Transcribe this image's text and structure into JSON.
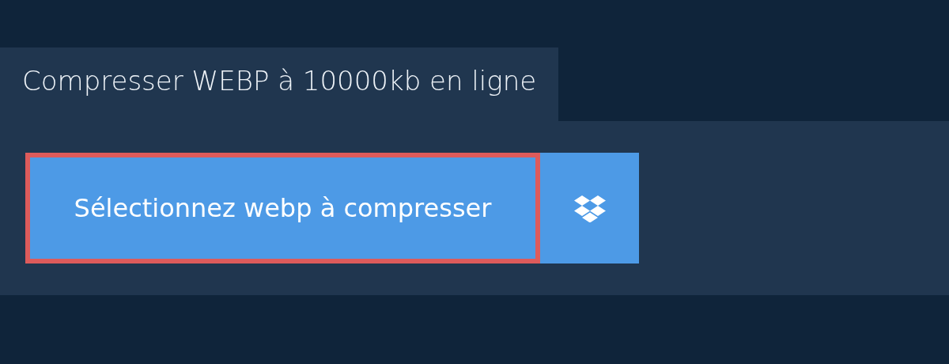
{
  "tab": {
    "title": "Compresser WEBP à 10000kb en ligne"
  },
  "upload": {
    "label": "Sélectionnez webp à compresser",
    "focused": true
  }
}
